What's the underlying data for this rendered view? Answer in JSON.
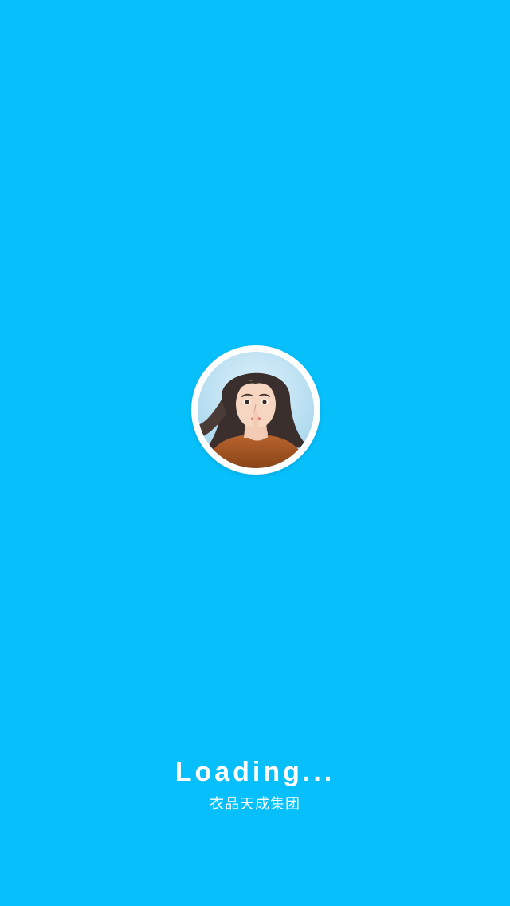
{
  "splash": {
    "background_color": "#07c0fb",
    "avatar_icon": "avatar-portrait-icon",
    "loading_label": "Loading...",
    "company_name": "衣品天成集团"
  }
}
